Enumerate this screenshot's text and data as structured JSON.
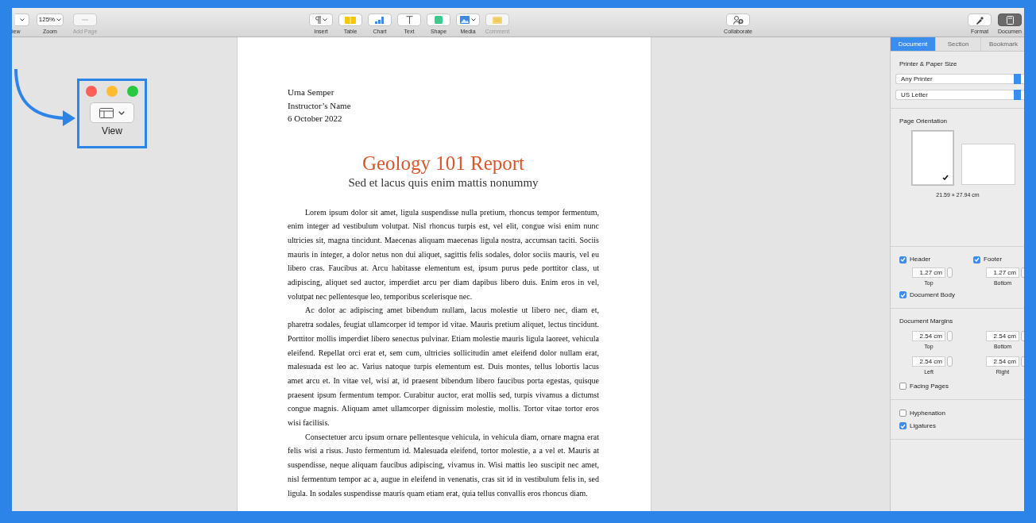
{
  "toolbar": {
    "left": [
      {
        "kind": "view_partial",
        "label": "iew",
        "menu": true,
        "disabled": false,
        "selected": false
      },
      {
        "kind": "zoom",
        "value": "125%",
        "label": "Zoom",
        "menu": true,
        "disabled": false,
        "selected": false
      },
      {
        "kind": "add_page",
        "label": "Add Page",
        "menu": false,
        "disabled": true,
        "selected": false
      }
    ],
    "center": [
      {
        "kind": "insert",
        "label": "Insert",
        "menu": true,
        "disabled": false,
        "selected": false
      },
      {
        "kind": "table",
        "label": "Table",
        "menu": false,
        "disabled": false,
        "selected": false
      },
      {
        "kind": "chart",
        "label": "Chart",
        "menu": false,
        "disabled": false,
        "selected": false
      },
      {
        "kind": "text",
        "label": "Text",
        "menu": false,
        "disabled": false,
        "selected": false
      },
      {
        "kind": "shape",
        "label": "Shape",
        "menu": false,
        "disabled": false,
        "selected": false
      },
      {
        "kind": "media",
        "label": "Media",
        "menu": true,
        "disabled": false,
        "selected": false
      },
      {
        "kind": "comment",
        "label": "Comment",
        "menu": false,
        "disabled": true,
        "selected": false
      }
    ],
    "middle": [
      {
        "kind": "collaborate",
        "label": "Collaborate",
        "menu": false,
        "disabled": false,
        "selected": false
      }
    ],
    "right": [
      {
        "kind": "format",
        "label": "Format",
        "menu": false,
        "disabled": false,
        "selected": false
      },
      {
        "kind": "document",
        "label": "Documen",
        "menu": false,
        "disabled": false,
        "selected": true
      }
    ]
  },
  "callout": {
    "label": "View"
  },
  "document": {
    "author": "Urna Semper",
    "instructor": "Instructor’s Name",
    "date": "6 October 2022",
    "title": "Geology 101 Report",
    "subtitle": "Sed et lacus quis enim mattis nonummy",
    "paragraphs": [
      "Lorem ipsum dolor sit amet, ligula suspendisse nulla pretium, rhoncus tempor fermentum, enim integer ad vestibulum volutpat. Nisl rhoncus turpis est, vel elit, congue wisi enim nunc ultricies sit, magna tincidunt. Maecenas aliquam maecenas ligula nostra, accumsan taciti. Sociis mauris in integer, a dolor netus non dui aliquet, sagittis felis sodales, dolor sociis mauris, vel eu libero cras. Faucibus at. Arcu habitasse elementum est, ipsum purus pede porttitor class, ut adipiscing, aliquet sed auctor, imperdiet arcu per diam dapibus libero duis. Enim eros in vel, volutpat nec pellentesque leo, temporibus scelerisque nec.",
      "Ac dolor ac adipiscing amet bibendum nullam, lacus molestie ut libero nec, diam et, pharetra sodales, feugiat ullamcorper id tempor id vitae. Mauris pretium aliquet, lectus tincidunt. Porttitor mollis imperdiet libero senectus pulvinar. Etiam molestie mauris ligula laoreet, vehicula eleifend. Repellat orci erat et, sem cum, ultricies sollicitudin amet eleifend dolor nullam erat, malesuada est leo ac. Varius natoque turpis elementum est. Duis montes, tellus lobortis lacus amet arcu et. In vitae vel, wisi at, id praesent bibendum libero faucibus porta egestas, quisque praesent ipsum fermentum tempor. Curabitur auctor, erat mollis sed, turpis vivamus a dictumst congue magnis. Aliquam amet ullamcorper dignissim molestie, mollis. Tortor vitae tortor eros wisi facilisis.",
      "Consectetuer arcu ipsum ornare pellentesque vehicula, in vehicula diam, ornare magna erat felis wisi a risus. Justo fermentum id. Malesuada eleifend, tortor molestie, a a vel et. Mauris at suspendisse, neque aliquam faucibus adipiscing, vivamus in. Wisi mattis leo suscipit nec amet, nisl fermentum tempor ac a, augue in eleifend in venenatis, cras sit id in vestibulum felis in, sed ligula. In sodales suspendisse mauris quam etiam erat, quia tellus convallis eros rhoncus diam."
    ]
  },
  "inspector": {
    "tabs": [
      {
        "label": "Document",
        "selected": true
      },
      {
        "label": "Section",
        "selected": false
      },
      {
        "label": "Bookmark",
        "selected": false
      }
    ],
    "printer": {
      "heading": "Printer & Paper Size",
      "printer": "Any Printer",
      "paper": "US Letter"
    },
    "orientation": {
      "heading": "Page Orientation",
      "options": [
        {
          "kind": "portrait",
          "selected": true
        },
        {
          "kind": "landscape",
          "selected": false
        }
      ],
      "size": "21.59 × 27.94 cm"
    },
    "header": {
      "label": "Header",
      "checked": true,
      "value": "1.27 cm",
      "caption": "Top"
    },
    "footer": {
      "label": "Footer",
      "checked": true,
      "value": "1.27 cm",
      "caption": "Bottom"
    },
    "document_body": {
      "label": "Document Body",
      "checked": true
    },
    "margins": {
      "heading": "Document Margins",
      "fields": [
        {
          "value": "2.54 cm",
          "caption": "Top"
        },
        {
          "value": "2.54 cm",
          "caption": "Bottom"
        },
        {
          "value": "2.54 cm",
          "caption": "Left"
        },
        {
          "value": "2.54 cm",
          "caption": "Right"
        }
      ]
    },
    "facing_pages": {
      "label": "Facing Pages",
      "checked": false
    },
    "hyphenation": {
      "label": "Hyphenation",
      "checked": false
    },
    "ligatures": {
      "label": "Ligatures",
      "checked": true
    }
  }
}
